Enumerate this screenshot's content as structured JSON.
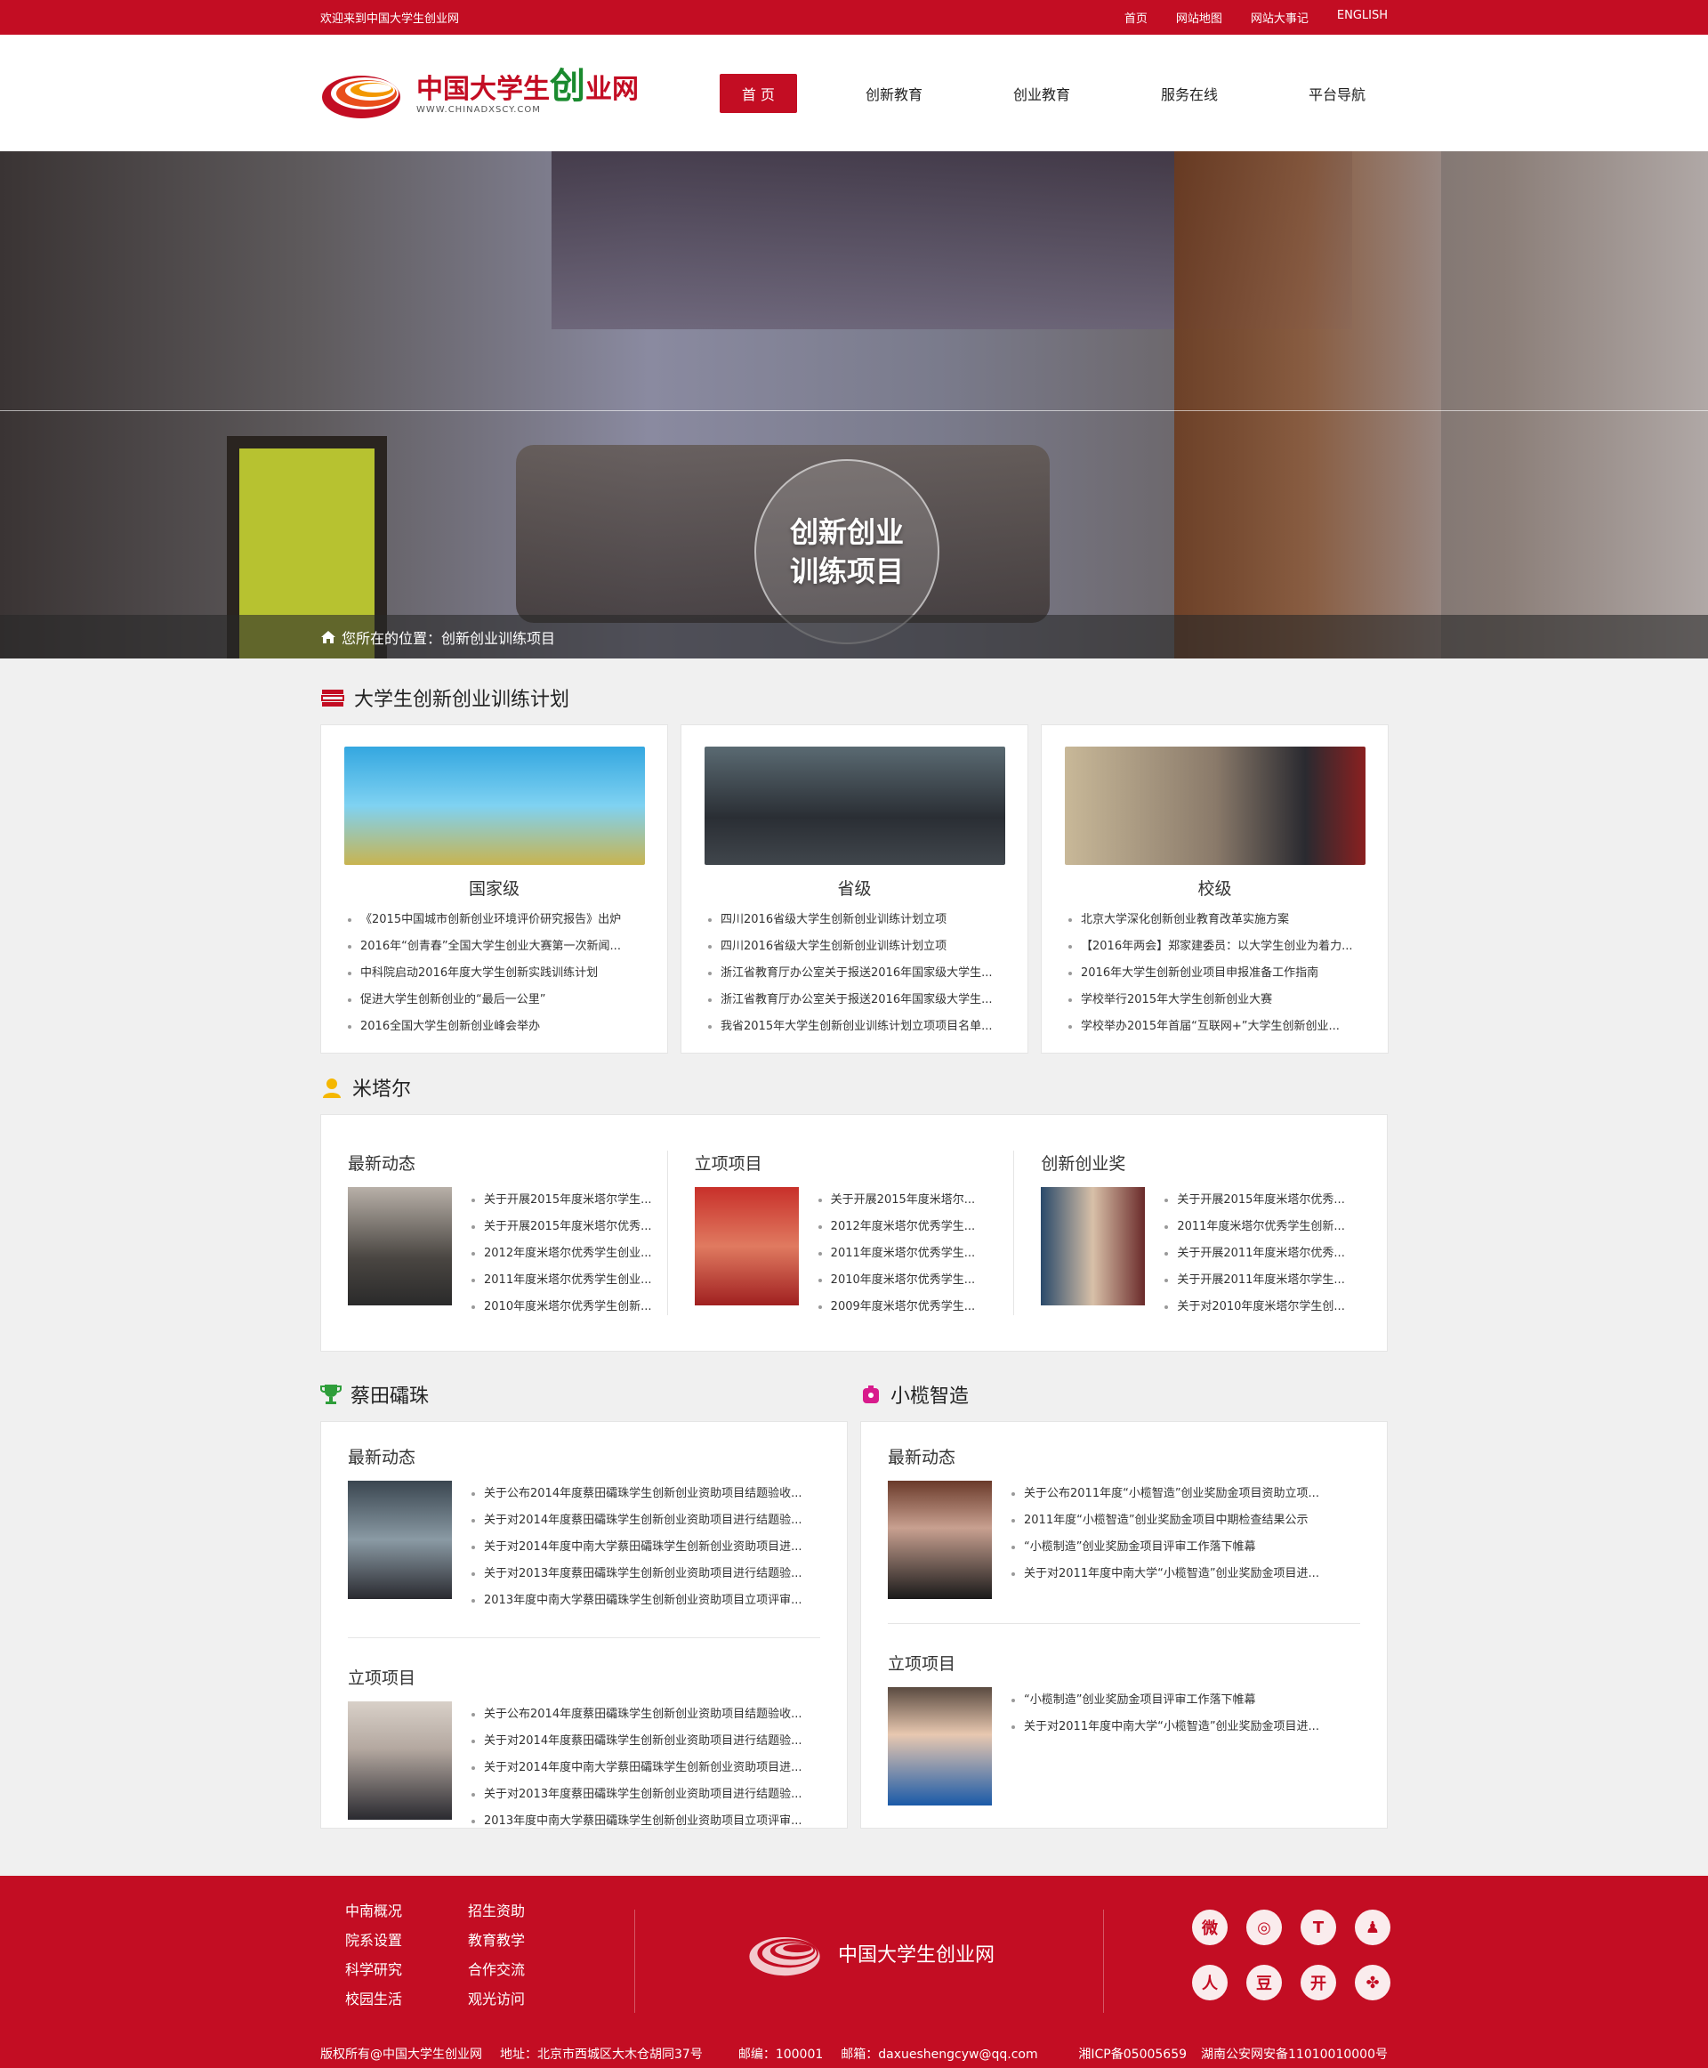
{
  "topbar": {
    "welcome": "欢迎来到中国大学生创业网",
    "links": [
      "首页",
      "网站地图",
      "网站大事记",
      "ENGLISH"
    ]
  },
  "header": {
    "logo_main": "中国大学生",
    "logo_accent": "创",
    "logo_tail": "业网",
    "logo_en": "WWW.CHINADXSCY.COM",
    "nav": [
      "首 页",
      "创新教育",
      "创业教育",
      "服务在线",
      "平台导航"
    ]
  },
  "banner": {
    "title_line1": "创新创业",
    "title_line2": "训练项目",
    "breadcrumb": "您所在的位置：创新创业训练项目"
  },
  "training": {
    "title": "大学生创新创业训练计划",
    "cards": [
      {
        "heading": "国家级",
        "items": [
          "《2015中国城市创新创业环境评价研究报告》出炉",
          "2016年“创青春”全国大学生创业大赛第一次新闻...",
          "中科院启动2016年度大学生创新实践训练计划",
          "促进大学生创新创业的“最后一公里”",
          "2016全国大学生创新创业峰会举办"
        ]
      },
      {
        "heading": "省级",
        "items": [
          "四川2016省级大学生创新创业训练计划立项",
          "四川2016省级大学生创新创业训练计划立项",
          "浙江省教育厅办公室关于报送2016年国家级大学生...",
          "浙江省教育厅办公室关于报送2016年国家级大学生...",
          "我省2015年大学生创新创业训练计划立项项目名单..."
        ]
      },
      {
        "heading": "校级",
        "items": [
          "北京大学深化创新创业教育改革实施方案",
          "【2016年两会】郑家建委员：以大学生创业为着力...",
          "2016年大学生创新创业项目申报准备工作指南",
          "学校举行2015年大学生创新创业大赛",
          "学校举办2015年首届“互联网+”大学生创新创业..."
        ]
      }
    ]
  },
  "mitar": {
    "title": "米塔尔",
    "cols": [
      {
        "heading": "最新动态",
        "items": [
          "关于开展2015年度米塔尔学生...",
          "关于开展2015年度米塔尔优秀...",
          "2012年度米塔尔优秀学生创业...",
          "2011年度米塔尔优秀学生创业...",
          "2010年度米塔尔优秀学生创新..."
        ]
      },
      {
        "heading": "立项项目",
        "items": [
          "关于开展2015年度米塔尔...",
          "2012年度米塔尔优秀学生...",
          "2011年度米塔尔优秀学生...",
          "2010年度米塔尔优秀学生...",
          "2009年度米塔尔优秀学生..."
        ]
      },
      {
        "heading": "创新创业奖",
        "items": [
          "关于开展2015年度米塔尔优秀...",
          "2011年度米塔尔优秀学生创新...",
          "关于开展2011年度米塔尔优秀...",
          "关于开展2011年度米塔尔学生...",
          "关于对2010年度米塔尔学生创..."
        ]
      }
    ]
  },
  "caitian": {
    "title": "蔡田礵珠",
    "blocks": [
      {
        "heading": "最新动态",
        "items": [
          "关于公布2014年度蔡田礵珠学生创新创业资助项目结题验收...",
          "关于对2014年度蔡田礵珠学生创新创业资助项目进行结题验...",
          "关于对2014年度中南大学蔡田礵珠学生创新创业资助项目进...",
          "关于对2013年度蔡田礵珠学生创新创业资助项目进行结题验...",
          "2013年度中南大学蔡田礵珠学生创新创业资助项目立项评审..."
        ]
      },
      {
        "heading": "立项项目",
        "items": [
          "关于公布2014年度蔡田礵珠学生创新创业资助项目结题验收...",
          "关于对2014年度蔡田礵珠学生创新创业资助项目进行结题验...",
          "关于对2014年度中南大学蔡田礵珠学生创新创业资助项目进...",
          "关于对2013年度蔡田礵珠学生创新创业资助项目进行结题验...",
          "2013年度中南大学蔡田礵珠学生创新创业资助项目立项评审..."
        ]
      }
    ]
  },
  "xiaolan": {
    "title": "小榄智造",
    "blocks": [
      {
        "heading": "最新动态",
        "items": [
          "关于公布2011年度“小榄智造”创业奖励金项目资助立项...",
          "2011年度“小榄智造”创业奖励金项目中期检查结果公示",
          "“小榄制造”创业奖励金项目评审工作落下帷幕",
          "关于对2011年度中南大学“小榄智造”创业奖励金项目进..."
        ]
      },
      {
        "heading": "立项项目",
        "items": [
          "“小榄制造”创业奖励金项目评审工作落下帷幕",
          "关于对2011年度中南大学“小榄智造”创业奖励金项目进..."
        ]
      }
    ]
  },
  "footer": {
    "links": [
      "中南概况",
      "招生资助",
      "院系设置",
      "教育教学",
      "科学研究",
      "合作交流",
      "校园生活",
      "观光访问"
    ],
    "site_name": "中国大学生创业网",
    "copyright": "版权所有@中国大学生创业网",
    "address": "地址：北京市西城区大木仓胡同37号",
    "postcode": "邮编：100001",
    "email": "邮箱：daxueshengcyw@qq.com",
    "icp": "湘ICP备05005659",
    "police": "湖南公安网安备11010010000号",
    "social_icons": [
      "weibo-icon",
      "wechat-icon",
      "tencent-weibo-icon",
      "qq-icon",
      "renren-icon",
      "douban-icon",
      "kaixin-icon",
      "clover-icon"
    ]
  },
  "colors": {
    "brand": "#c30d23",
    "accent_green": "#1a8a2e"
  }
}
